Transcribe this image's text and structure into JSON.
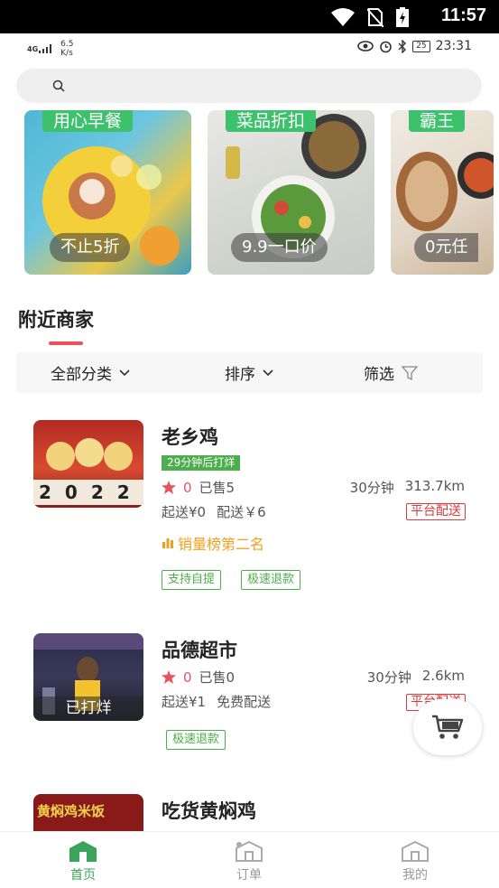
{
  "system_status": {
    "time": "11:57"
  },
  "inner_status": {
    "network": "4G",
    "speed_value": "6.5",
    "speed_unit": "K/s",
    "battery": "25",
    "time": "23:31"
  },
  "banners": [
    {
      "tag": "用心早餐",
      "caption": "不止5折"
    },
    {
      "tag": "菜品折扣",
      "caption": "9.9一口价"
    },
    {
      "tag": "霸王",
      "caption": "0元任"
    }
  ],
  "section_title": "附近商家",
  "filters": {
    "category": "全部分类",
    "sort": "排序",
    "filter": "筛选"
  },
  "stores": [
    {
      "name": "老乡鸡",
      "badge": "29分钟后打烊",
      "rating": "0",
      "sold": "已售5",
      "time": "30分钟",
      "distance": "313.7km",
      "min_order": "起送¥0",
      "delivery_fee": "配送￥6",
      "delivery_type": "平台配送",
      "rank": "销量榜第二名",
      "chips": [
        "支持自提",
        "极速退款"
      ],
      "thumb_text": "2022"
    },
    {
      "name": "品德超市",
      "overlay": "已打烊",
      "rating": "0",
      "sold": "已售0",
      "time": "30分钟",
      "distance": "2.6km",
      "min_order": "起送¥1",
      "delivery_fee": "免费配送",
      "delivery_type": "平台配送",
      "chips": [
        "极速退款"
      ]
    },
    {
      "name": "吃货黄焖鸡",
      "thumb_text": "黄焖鸡米饭"
    }
  ],
  "tabs": [
    {
      "label": "首页"
    },
    {
      "label": "订单"
    },
    {
      "label": "我的"
    }
  ],
  "colors": {
    "accent": "#3aa55a",
    "danger": "#e0393e",
    "rank": "#f0a020"
  }
}
